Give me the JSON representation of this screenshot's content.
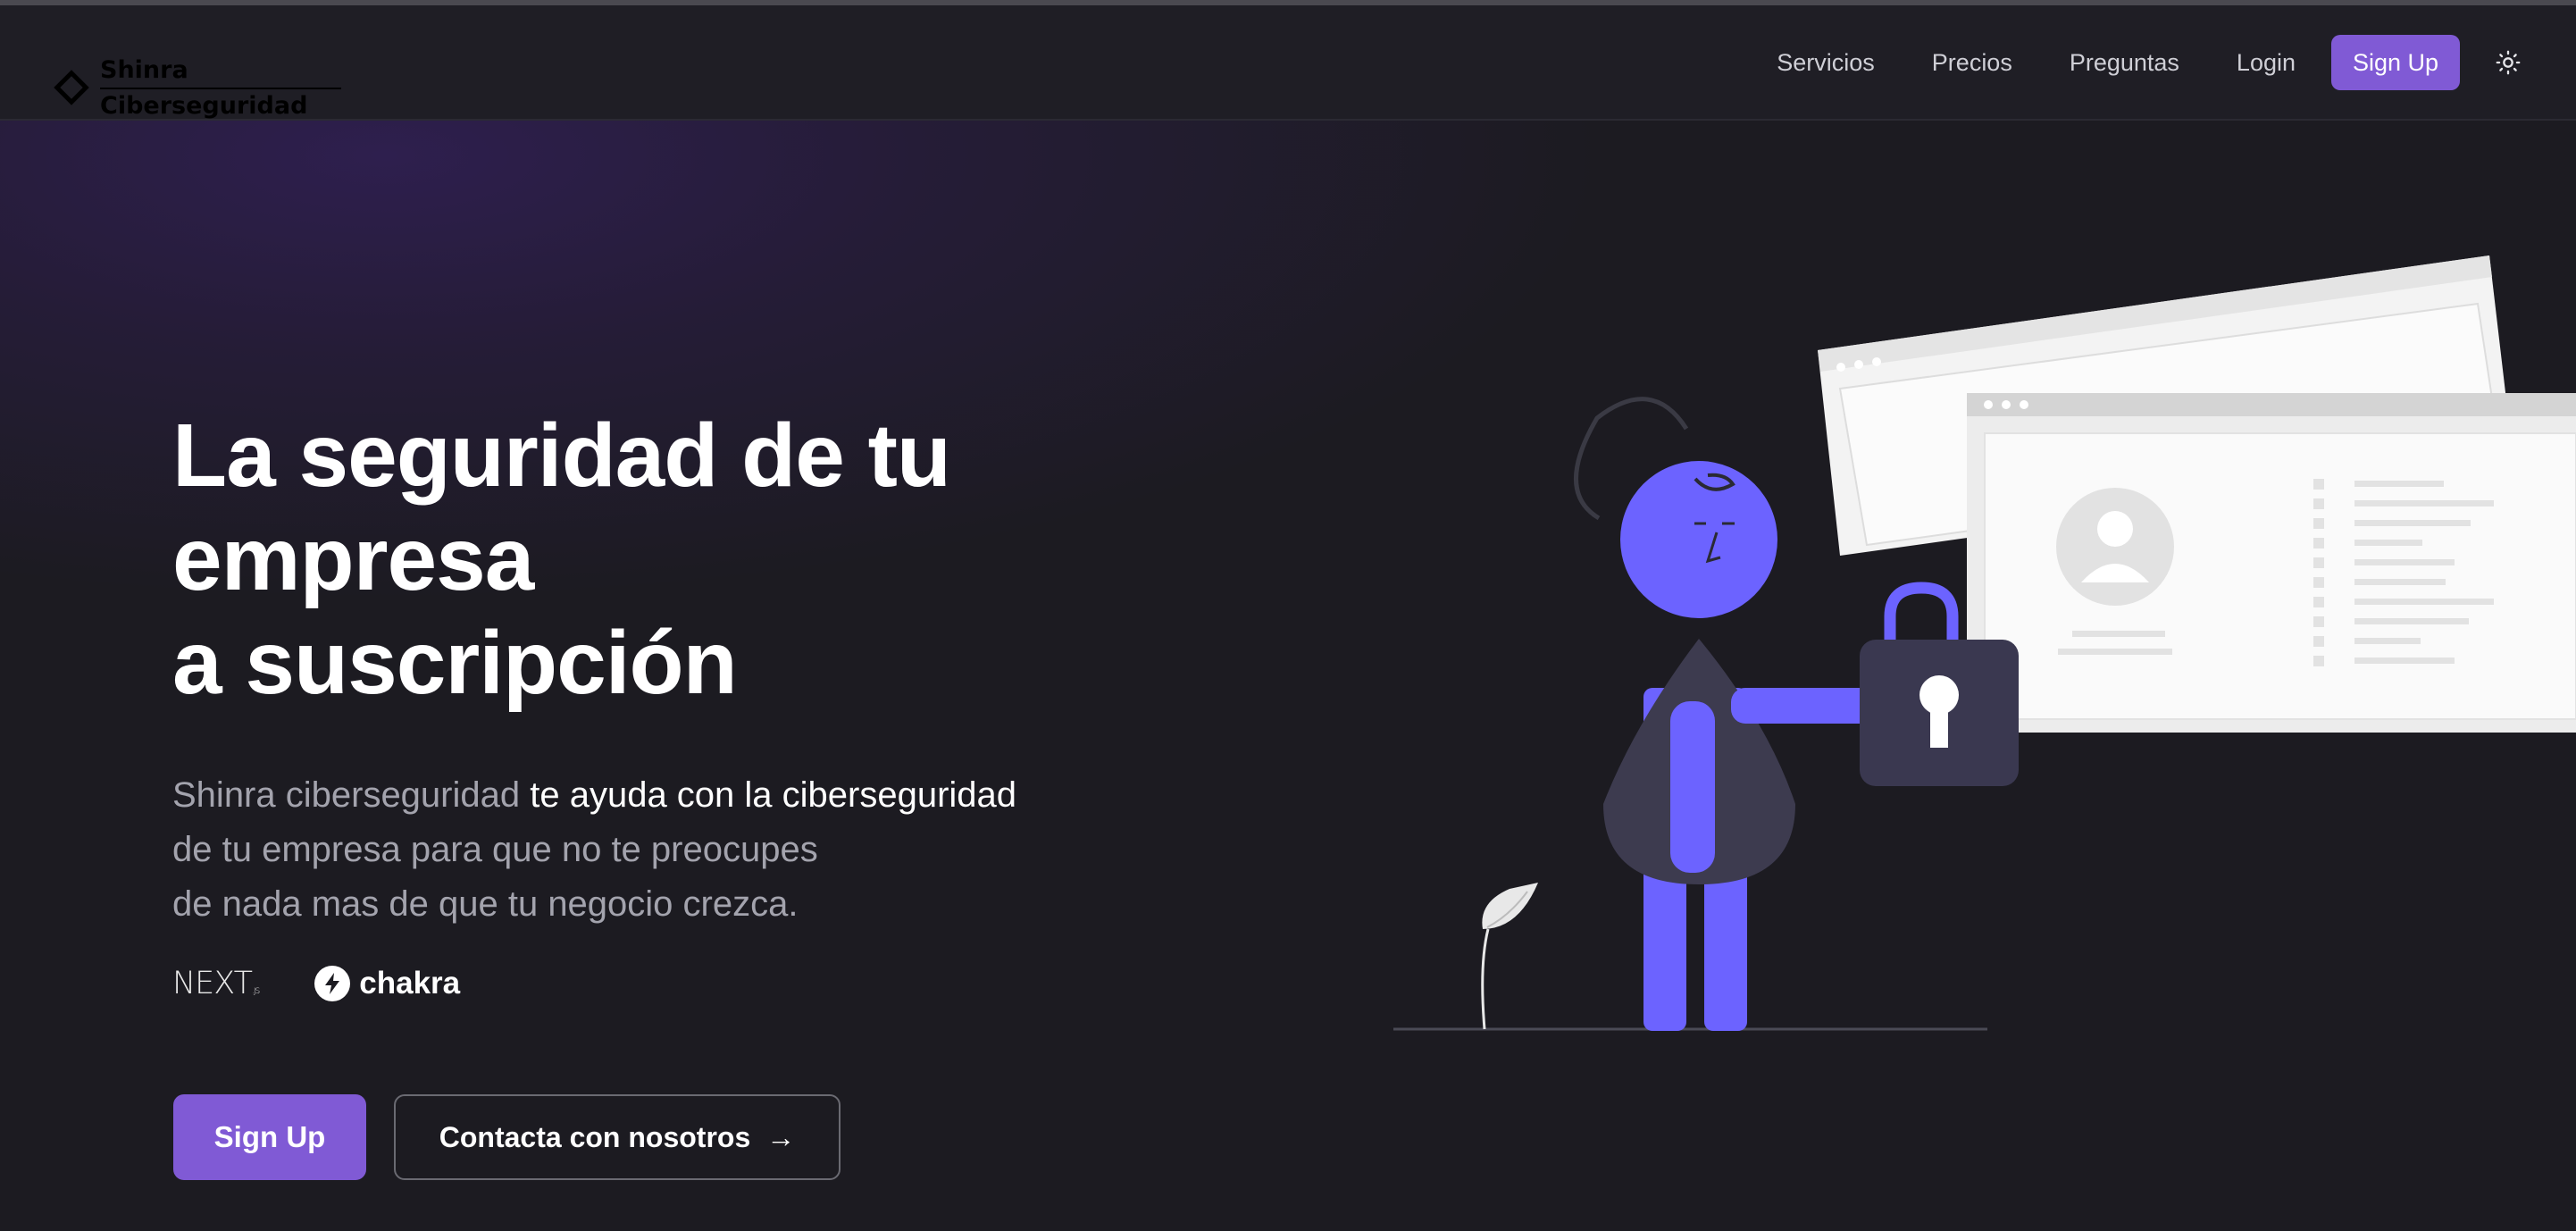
{
  "brand": {
    "line1": "Shinra",
    "line2": "Ciberseguridad"
  },
  "nav": {
    "links": [
      "Servicios",
      "Precios",
      "Preguntas",
      "Login"
    ],
    "signup_label": "Sign Up",
    "theme_icon": "sun-icon"
  },
  "hero": {
    "headline": [
      "La seguridad de tu",
      "empresa",
      "a suscripción"
    ],
    "description": {
      "highlight_brand": "Shinra ciberseguridad",
      "line1_rest": " te ayuda con la ciberseguridad",
      "line2": "de tu empresa para que no te preocupes",
      "line3": "de nada mas de que tu negocio crezca."
    },
    "tech_logos": {
      "next": "NEXT",
      "next_suffix": ".JS",
      "chakra": "chakra"
    },
    "primary_button": "Sign Up",
    "secondary_button": "Contacta con nosotros",
    "secondary_icon": "arrow-right-icon"
  },
  "colors": {
    "accent": "#805ad5",
    "illustration_accent": "#6c63ff",
    "background": "#1c1b21",
    "highlight_text": "#ffffff",
    "muted_text": "#a3a3ad"
  }
}
